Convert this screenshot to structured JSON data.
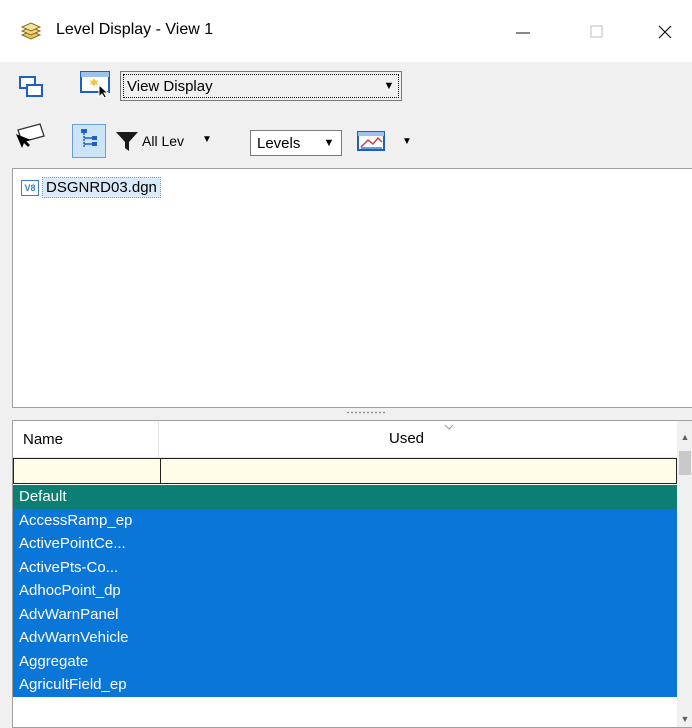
{
  "window": {
    "title": "Level Display - View 1"
  },
  "toolbar1": {
    "mode_select": "View Display"
  },
  "toolbar2": {
    "filter_label": "All Lev",
    "levels_select": "Levels"
  },
  "tree": {
    "items": [
      {
        "badge": "V8",
        "label": "DSGNRD03.dgn"
      }
    ]
  },
  "list": {
    "columns": [
      "Name",
      "Used"
    ],
    "rows": [
      "Default",
      "AccessRamp_ep",
      "ActivePointCe...",
      "ActivePts-Co...",
      "AdhocPoint_dp",
      "AdvWarnPanel",
      "AdvWarnVehicle",
      "Aggregate",
      "AgricultField_ep"
    ]
  },
  "colors": {
    "selection_blue": "#0a76d8",
    "active_row_teal": "#0d7e73",
    "filter_row_bg": "#fffde8"
  }
}
